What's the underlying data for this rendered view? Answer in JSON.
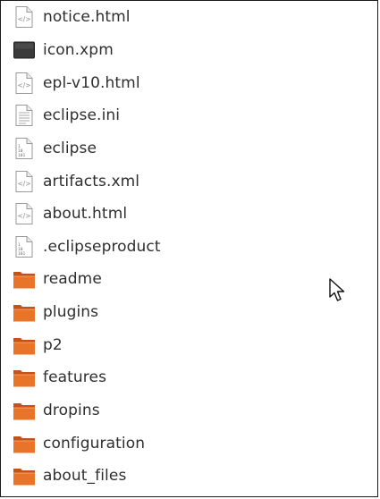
{
  "files": [
    {
      "name": "notice.html",
      "icon": "html-file-icon",
      "kind": "html"
    },
    {
      "name": "icon.xpm",
      "icon": "image-file-icon",
      "kind": "image"
    },
    {
      "name": "epl-v10.html",
      "icon": "html-file-icon",
      "kind": "html"
    },
    {
      "name": "eclipse.ini",
      "icon": "text-file-icon",
      "kind": "text"
    },
    {
      "name": "eclipse",
      "icon": "binary-file-icon",
      "kind": "binary"
    },
    {
      "name": "artifacts.xml",
      "icon": "html-file-icon",
      "kind": "html"
    },
    {
      "name": "about.html",
      "icon": "html-file-icon",
      "kind": "html"
    },
    {
      "name": ".eclipseproduct",
      "icon": "binary-file-icon",
      "kind": "binary"
    },
    {
      "name": "readme",
      "icon": "folder-icon",
      "kind": "folder"
    },
    {
      "name": "plugins",
      "icon": "folder-icon",
      "kind": "folder"
    },
    {
      "name": "p2",
      "icon": "folder-icon",
      "kind": "folder"
    },
    {
      "name": "features",
      "icon": "folder-icon",
      "kind": "folder"
    },
    {
      "name": "dropins",
      "icon": "folder-icon",
      "kind": "folder"
    },
    {
      "name": "configuration",
      "icon": "folder-icon",
      "kind": "folder"
    },
    {
      "name": "about_files",
      "icon": "folder-icon",
      "kind": "folder"
    }
  ],
  "colors": {
    "folder_front": "#e8742a",
    "folder_back": "#c4521a",
    "text": "#2e2e2e",
    "icon_dark": "#3a3a3a"
  }
}
